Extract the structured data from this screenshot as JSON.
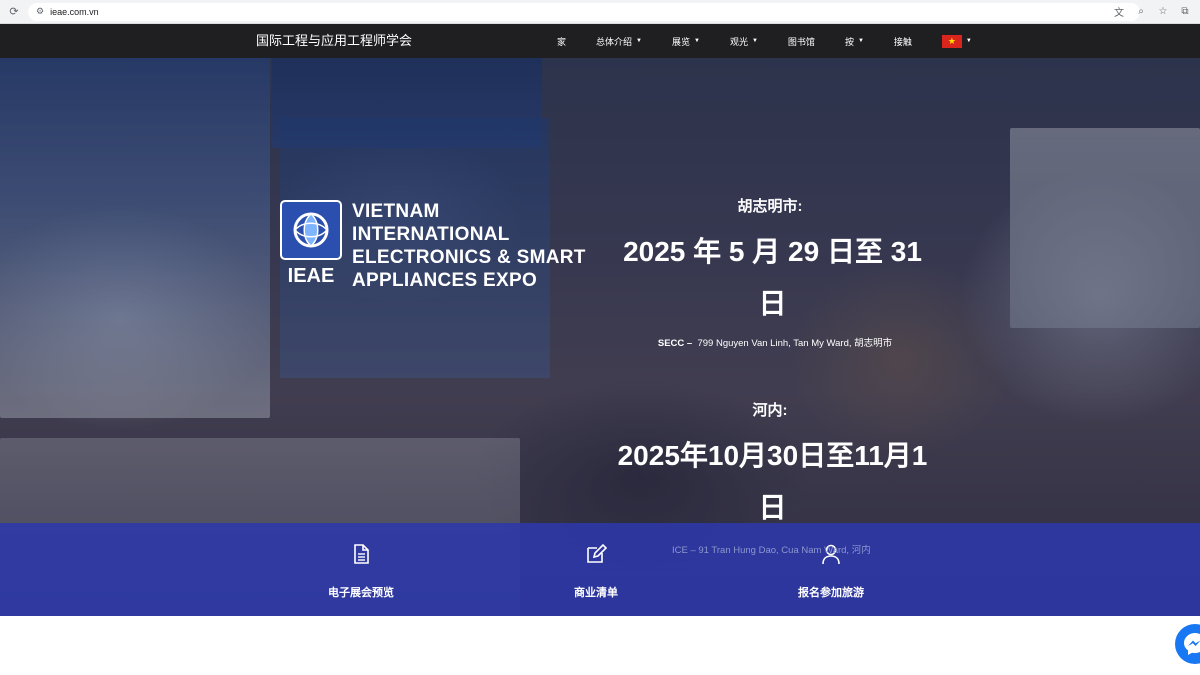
{
  "browser": {
    "url": "ieae.com.vn",
    "icons": [
      "reload-icon",
      "tune-icon",
      "translate-icon",
      "zoom-icon",
      "star-icon",
      "extensions-icon"
    ]
  },
  "nav": {
    "brand": "国际工程与应用工程师学会",
    "items": [
      {
        "label": "家",
        "dropdown": false
      },
      {
        "label": "总体介绍",
        "dropdown": true
      },
      {
        "label": "展览",
        "dropdown": true
      },
      {
        "label": "观光",
        "dropdown": true
      },
      {
        "label": "图书馆",
        "dropdown": false
      },
      {
        "label": "按",
        "dropdown": true
      },
      {
        "label": "接触",
        "dropdown": false
      }
    ],
    "flag": "vietnam-flag"
  },
  "logo": {
    "abbr": "IEAE",
    "line1": "VIETNAM",
    "line2": "INTERNATIONAL",
    "line3": "ELECTRONICS & SMART",
    "line4": "APPLIANCES EXPO"
  },
  "events": {
    "hcm": {
      "city": "胡志明市:",
      "dates_line1": "2025 年 5 月 29 日至 31",
      "dates_line2": "日",
      "venue": "SECC –",
      "address": "799 Nguyen Van Linh, Tan My Ward, 胡志明市"
    },
    "hanoi": {
      "city": "河内:",
      "dates_line1": "2025年10月30日至11月1",
      "dates_line2": "日",
      "address": "ICE – 91 Tran Hung Dao, Cua Nam Ward, 河内"
    }
  },
  "features": [
    {
      "label": "电子展会预览",
      "icon": "document-icon"
    },
    {
      "label": "商业清单",
      "icon": "edit-icon"
    },
    {
      "label": "报名参加旅游",
      "icon": "user-icon"
    }
  ],
  "colors": {
    "nav_bg": "#1f1f21",
    "feature_bar": "#2c38aa",
    "logo_blue": "#2b4fae",
    "messenger": "#1877f2"
  }
}
